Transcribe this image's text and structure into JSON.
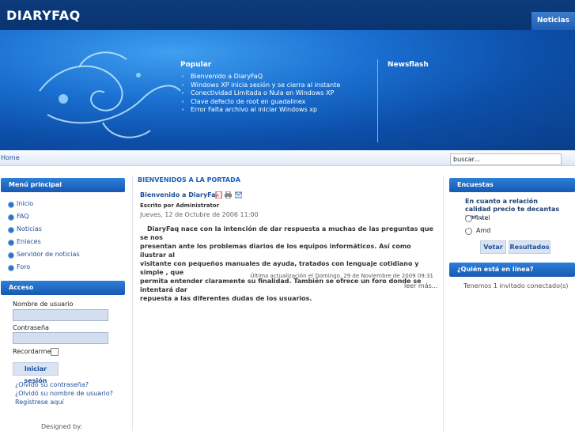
{
  "site": {
    "logo": "DIARYFAQ",
    "nav_button": "Noticias"
  },
  "popular": {
    "title": "Popular",
    "items": [
      "Bienvenido a DiaryFaQ",
      "Windows XP inicia sesión y se cierra al instante",
      "Conectividad Limitada o Nula en Windows XP",
      "Clave defecto de root en guadalinex",
      "Error Falta archivo al iniciar Windows xp"
    ]
  },
  "newsflash": {
    "title": "Newsflash"
  },
  "breadcrumb": "Home",
  "search": {
    "value": "buscar..."
  },
  "main_menu": {
    "title": "Menú principal",
    "items": [
      "Inicio",
      "FAQ",
      "Noticias",
      "Enlaces",
      "Servidor de noticias",
      "Foro"
    ]
  },
  "login": {
    "title": "Acceso",
    "username_label": "Nombre de usuario",
    "password_label": "Contraseña",
    "remember_label": "Recordarme",
    "submit": "Iniciar sesión",
    "forgot_password": "¿Olvidó su contraseña?",
    "forgot_username": "¿Olvidó su nombre de usuario?",
    "register": "Regístrese aquí"
  },
  "footer": {
    "designed_by": "Designed by:"
  },
  "content": {
    "heading": "BIENVENIDOS A LA PORTADA",
    "article_title": "Bienvenido a DiaryFaQ",
    "author": "Escrito por Administrator",
    "date": "Jueves, 12 de Octubre de 2006 11:00",
    "body_lines": [
      "DiaryFaq nace con la intención de dar respuesta a muchas de las preguntas que se nos",
      "presentan ante los problemas diarios de los equipos informáticos. Así como ilustrar al",
      "visitante con pequeños manuales de ayuda, tratados con lenguaje cotidiano y  simple , que",
      "permita entender claramente su finalidad. También se ofrece un foro donde se intentará dar",
      "repuesta a las diferentes dudas de los usuarios."
    ],
    "updated": "Última actualización el Domingo, 29 de Noviembre de 2009 09:31",
    "read_more": "leer más..."
  },
  "poll": {
    "title": "Encuestas",
    "question": "En cuanto a relación calidad precio te decantas por ...",
    "options": [
      "Intel",
      "Amd"
    ],
    "vote": "Votar",
    "results": "Resultados"
  },
  "online": {
    "title": "¿Quién está en línea?",
    "text": "Tenemos 1 invitado conectado(s)"
  }
}
